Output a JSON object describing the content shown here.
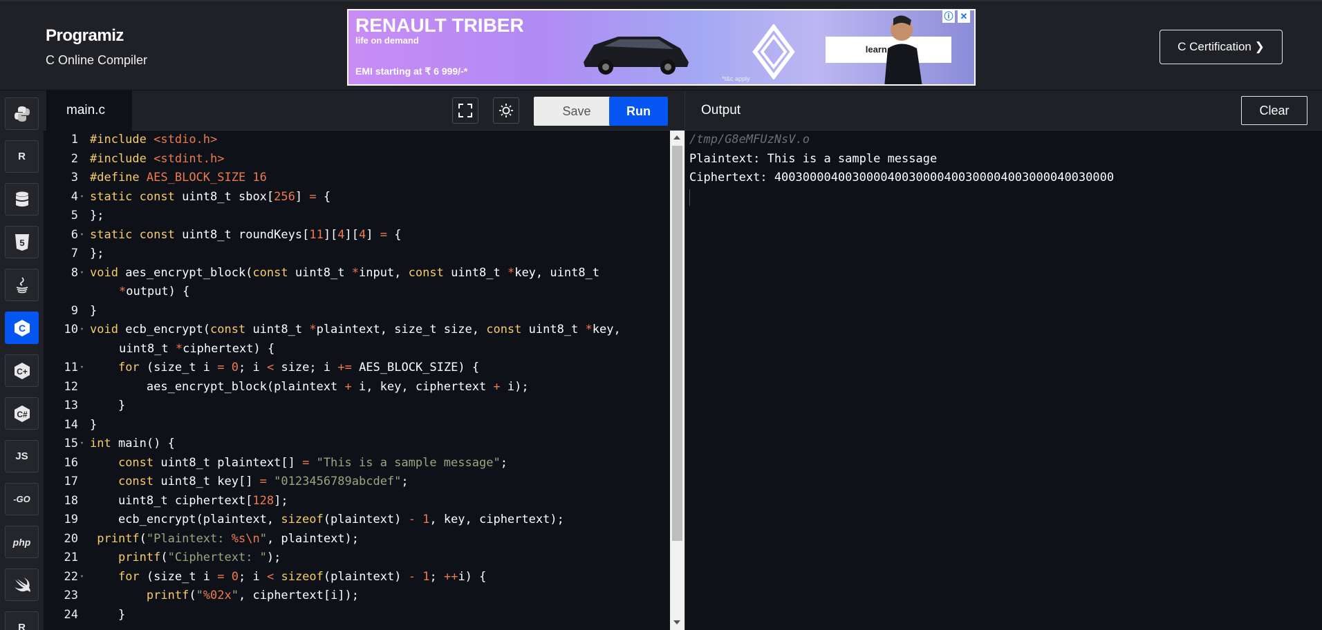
{
  "header": {
    "logo": "Programiz",
    "subtitle": "C Online Compiler",
    "ad": {
      "title": "RENAULT TRIBER",
      "tagline": "life on demand",
      "emi": "EMI starting at ₹ 6 999/-*",
      "terms": "*t&c apply",
      "cta": "learn more",
      "info_icon": "ⓘ",
      "close_icon": "✕"
    },
    "certification_button": "C Certification ❯"
  },
  "sidebar": {
    "items": [
      {
        "name": "python",
        "label": ""
      },
      {
        "name": "r",
        "label": "R"
      },
      {
        "name": "sql",
        "label": ""
      },
      {
        "name": "html",
        "label": "5"
      },
      {
        "name": "java",
        "label": ""
      },
      {
        "name": "c",
        "label": "C",
        "active": true
      },
      {
        "name": "cpp",
        "label": "C+"
      },
      {
        "name": "csharp",
        "label": "C#"
      },
      {
        "name": "js",
        "label": "JS"
      },
      {
        "name": "go",
        "label": "-GO"
      },
      {
        "name": "php",
        "label": "php"
      },
      {
        "name": "swift",
        "label": ""
      },
      {
        "name": "rust",
        "label": "R"
      }
    ]
  },
  "editor": {
    "tab": "main.c",
    "save_label": "Save",
    "run_label": "Run",
    "lines": [
      {
        "n": "1",
        "fold": false,
        "html": "<span class=\"pre\">#include</span> <span class=\"num\">&lt;stdio.h&gt;</span>"
      },
      {
        "n": "2",
        "fold": false,
        "html": "<span class=\"pre\">#include</span> <span class=\"num\">&lt;stdint.h&gt;</span>"
      },
      {
        "n": "3",
        "fold": false,
        "html": "<span class=\"pre\">#define</span> <span class=\"num\">AES_BLOCK_SIZE 16</span>"
      },
      {
        "n": "4",
        "fold": true,
        "html": "<span class=\"kw\">static</span> <span class=\"kw\">const</span> uint8_t sbox[<span class=\"num\">256</span>] <span class=\"op\">=</span> {"
      },
      {
        "n": "5",
        "fold": false,
        "html": "};"
      },
      {
        "n": "6",
        "fold": true,
        "html": "<span class=\"kw\">static</span> <span class=\"kw\">const</span> uint8_t roundKeys[<span class=\"num\">11</span>][<span class=\"num\">4</span>][<span class=\"num\">4</span>] <span class=\"op\">=</span> {"
      },
      {
        "n": "7",
        "fold": false,
        "html": "};"
      },
      {
        "n": "8",
        "fold": true,
        "html": "<span class=\"kw\">void</span> aes_encrypt_block(<span class=\"kw\">const</span> uint8_t <span class=\"op\">*</span>input, <span class=\"kw\">const</span> uint8_t <span class=\"op\">*</span>key, uint8_t"
      },
      {
        "n": "",
        "fold": false,
        "cont": true,
        "html": "<span class=\"op\">*</span>output) {"
      },
      {
        "n": "9",
        "fold": false,
        "html": "}"
      },
      {
        "n": "10",
        "fold": true,
        "html": "<span class=\"kw\">void</span> ecb_encrypt(<span class=\"kw\">const</span> uint8_t <span class=\"op\">*</span>plaintext, size_t size, <span class=\"kw\">const</span> uint8_t <span class=\"op\">*</span>key,"
      },
      {
        "n": "",
        "fold": false,
        "cont": true,
        "html": "uint8_t <span class=\"op\">*</span>ciphertext) {"
      },
      {
        "n": "11",
        "fold": true,
        "html": "    <span class=\"kw\">for</span> (size_t i <span class=\"op\">=</span> <span class=\"num\">0</span>; i <span class=\"op\">&lt;</span> size; i <span class=\"op\">+=</span> AES_BLOCK_SIZE) {"
      },
      {
        "n": "12",
        "fold": false,
        "html": "        aes_encrypt_block(plaintext <span class=\"op\">+</span> i, key, ciphertext <span class=\"op\">+</span> i);"
      },
      {
        "n": "13",
        "fold": false,
        "html": "    }"
      },
      {
        "n": "14",
        "fold": false,
        "html": "}"
      },
      {
        "n": "15",
        "fold": true,
        "html": "<span class=\"kw\">int</span> main() {"
      },
      {
        "n": "16",
        "fold": false,
        "html": "    <span class=\"kw\">const</span> uint8_t plaintext[] <span class=\"op\">=</span> <span class=\"str\">\"This is a sample message\"</span>;"
      },
      {
        "n": "17",
        "fold": false,
        "html": "    <span class=\"kw\">const</span> uint8_t key[] <span class=\"op\">=</span> <span class=\"str\">\"0123456789abcdef\"</span>;"
      },
      {
        "n": "18",
        "fold": false,
        "html": "    uint8_t ciphertext[<span class=\"num\">128</span>];"
      },
      {
        "n": "19",
        "fold": false,
        "html": "    ecb_encrypt(plaintext, <span class=\"kw\">sizeof</span>(plaintext) <span class=\"op\">-</span> <span class=\"num\">1</span>, key, ciphertext);"
      },
      {
        "n": "20",
        "fold": false,
        "html": " <span class=\"kw\">printf</span>(<span class=\"str\">\"Plaintext: </span><span class=\"num\">%s\\n</span><span class=\"str\">\"</span>, plaintext);"
      },
      {
        "n": "21",
        "fold": false,
        "html": "    <span class=\"kw\">printf</span>(<span class=\"str\">\"Ciphertext: \"</span>);"
      },
      {
        "n": "22",
        "fold": true,
        "html": "    <span class=\"kw\">for</span> (size_t i <span class=\"op\">=</span> <span class=\"num\">0</span>; i <span class=\"op\">&lt;</span> <span class=\"kw\">sizeof</span>(plaintext) <span class=\"op\">-</span> <span class=\"num\">1</span>; <span class=\"op\">++</span>i) {"
      },
      {
        "n": "23",
        "fold": false,
        "html": "        <span class=\"kw\">printf</span>(<span class=\"str\">\"</span><span class=\"num\">%02x</span><span class=\"str\">\"</span>, ciphertext[i]);"
      },
      {
        "n": "24",
        "fold": false,
        "html": "    }"
      }
    ]
  },
  "output": {
    "title": "Output",
    "clear_label": "Clear",
    "lines": [
      "/tmp/G8eMFUzNsV.o",
      "Plaintext: This is a sample message",
      "Ciphertext: 400300004003000040030000400300004003000040030000"
    ]
  }
}
